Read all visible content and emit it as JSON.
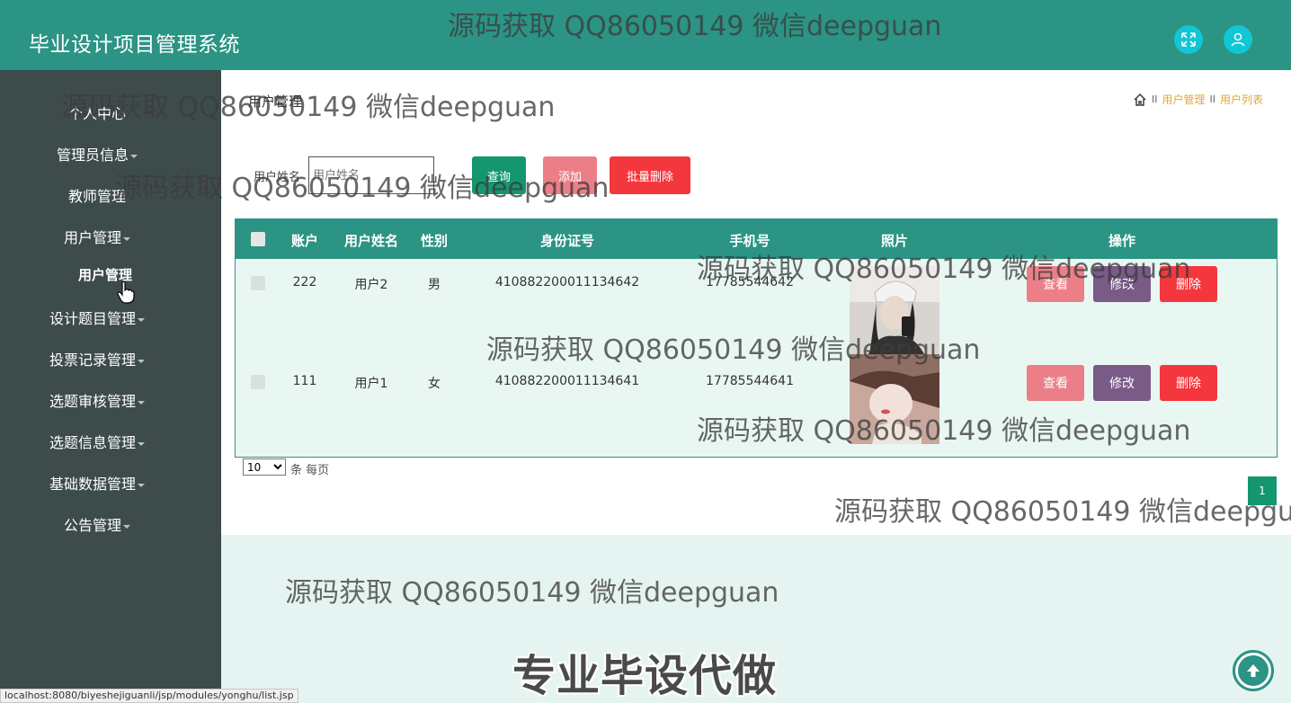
{
  "app": {
    "title": "毕业设计项目管理系统"
  },
  "header_icons": [
    "fullscreen-icon",
    "user-icon"
  ],
  "sidebar": {
    "items": [
      {
        "label": "个人中心",
        "has_caret": false
      },
      {
        "label": "管理员信息",
        "has_caret": true
      },
      {
        "label": "教师管理",
        "has_caret": false
      },
      {
        "label": "用户管理",
        "has_caret": true
      },
      {
        "label": "设计题目管理",
        "has_caret": true
      },
      {
        "label": "投票记录管理",
        "has_caret": true
      },
      {
        "label": "选题审核管理",
        "has_caret": true
      },
      {
        "label": "选题信息管理",
        "has_caret": true
      },
      {
        "label": "基础数据管理",
        "has_caret": true
      },
      {
        "label": "公告管理",
        "has_caret": true
      }
    ],
    "sub_item": {
      "label": "用户管理"
    }
  },
  "page": {
    "title": "用户管理",
    "breadcrumb": {
      "sep": "II",
      "items": [
        "用户管理",
        "用户列表"
      ]
    }
  },
  "search": {
    "label": "用户姓名",
    "placeholder": "用户姓名",
    "query_label": "查询",
    "add_label": "添加",
    "batch_delete_label": "批量删除"
  },
  "table": {
    "headers": [
      "账户",
      "用户姓名",
      "性别",
      "身份证号",
      "手机号",
      "照片",
      "操作"
    ],
    "rows": [
      {
        "account": "222",
        "name": "用户2",
        "gender": "男",
        "id_card": "410882200011134642",
        "phone": "17785544642",
        "photo": "photo-user2"
      },
      {
        "account": "111",
        "name": "用户1",
        "gender": "女",
        "id_card": "410882200011134641",
        "phone": "17785544641",
        "photo": "photo-user1"
      }
    ],
    "actions": {
      "view": "查看",
      "edit": "修改",
      "delete": "删除"
    }
  },
  "pagination": {
    "page_size": "10",
    "per_page_label": "条 每页",
    "current_page": "1"
  },
  "watermarks": {
    "text": "源码获取 QQ86050149 微信deepguan",
    "banner": "专业毕设代做"
  },
  "status_bar": {
    "url": "localhost:8080/biyeshejiguanli/jsp/modules/yonghu/list.jsp"
  },
  "colors": {
    "header": "#2b9484",
    "sidebar": "#3e4b4b",
    "accent_cyan": "#11c6d5",
    "breadcrumb": "#e2a53a",
    "query": "#14976f",
    "add": "#ec7e87",
    "delete": "#f3373d",
    "edit": "#7a5a87"
  }
}
